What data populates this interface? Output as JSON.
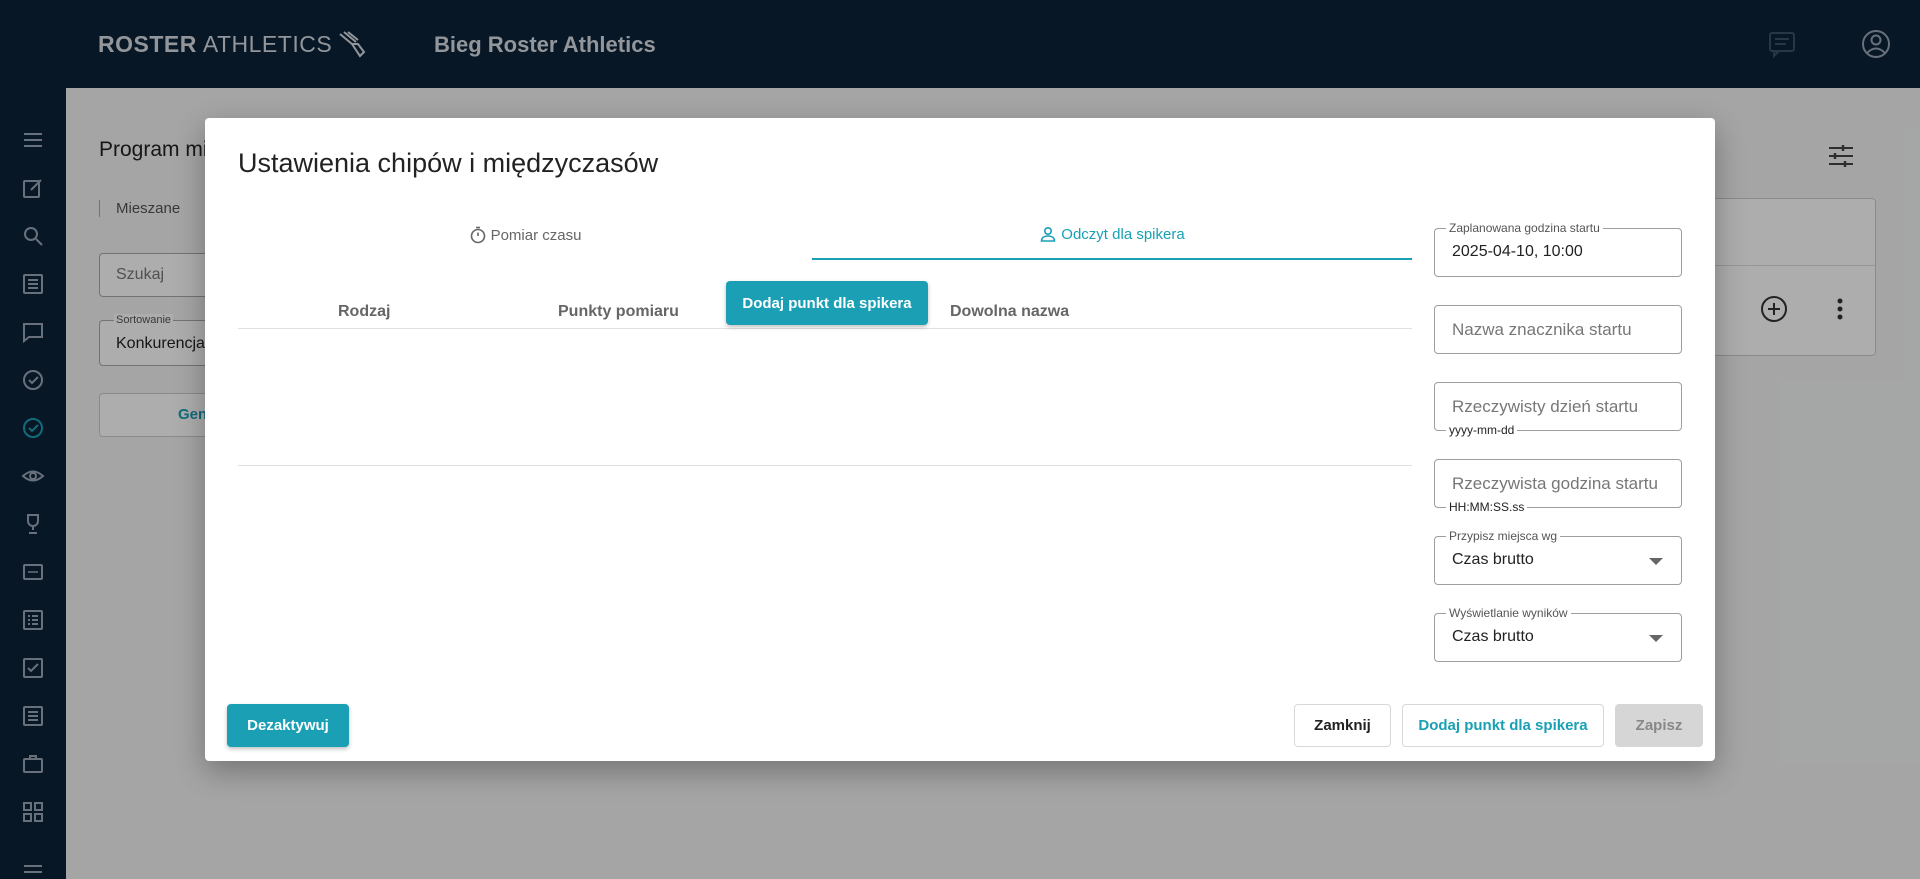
{
  "header": {
    "brand_bold": "ROSTER",
    "brand_light": "ATHLETICS",
    "app_title": "Bieg Roster Athletics",
    "icons": [
      "chat-icon",
      "account-icon"
    ]
  },
  "sidebar": {
    "icons": [
      "menu-icon",
      "edit-icon",
      "search-icon",
      "list-icon",
      "chat-icon",
      "check-circle-icon",
      "check-circle-active-icon",
      "eye-icon",
      "trophy-icon",
      "bib-icon",
      "results-list-icon",
      "checkbox-icon",
      "document-icon",
      "briefcase-icon",
      "grid-icon",
      "menu-bottom-icon"
    ]
  },
  "background": {
    "page_title": "Program mi",
    "tab_label": "Mieszane",
    "search_placeholder": "Szukaj",
    "sort_label": "Sortowanie",
    "sort_value": "Konkurencja",
    "generate_button": "Gene"
  },
  "dialog": {
    "title": "Ustawienia chipów i międzyczasów",
    "tabs": [
      {
        "label": "Pomiar czasu",
        "icon": "stopwatch-icon",
        "active": false
      },
      {
        "label": "Odczyt dla spikera",
        "icon": "person-icon",
        "active": true
      }
    ],
    "columns": [
      "Rodzaj",
      "Punkty pomiaru",
      "Dowolna nazwa"
    ],
    "add_point_button": "Dodaj punkt dla spikera",
    "fields": {
      "planned_start_label": "Zaplanowana godzina startu",
      "planned_start_value": "2025-04-10, 10:00",
      "start_marker_placeholder": "Nazwa znacznika startu",
      "actual_day_placeholder": "Rzeczywisty dzień startu",
      "actual_day_hint": "yyyy-mm-dd",
      "actual_time_placeholder": "Rzeczywista godzina startu",
      "actual_time_hint": "HH:MM:SS.ss",
      "assign_places_label": "Przypisz miejsca wg",
      "assign_places_value": "Czas brutto",
      "results_display_label": "Wyświetlanie wyników",
      "results_display_value": "Czas brutto"
    },
    "footer": {
      "deactivate_label": "Dezaktywuj",
      "close_label": "Zamknij",
      "add_point_label": "Dodaj punkt dla spikera",
      "save_label": "Zapisz"
    }
  },
  "colors": {
    "navy": "#0c2238",
    "accent": "#1a9fb5"
  }
}
